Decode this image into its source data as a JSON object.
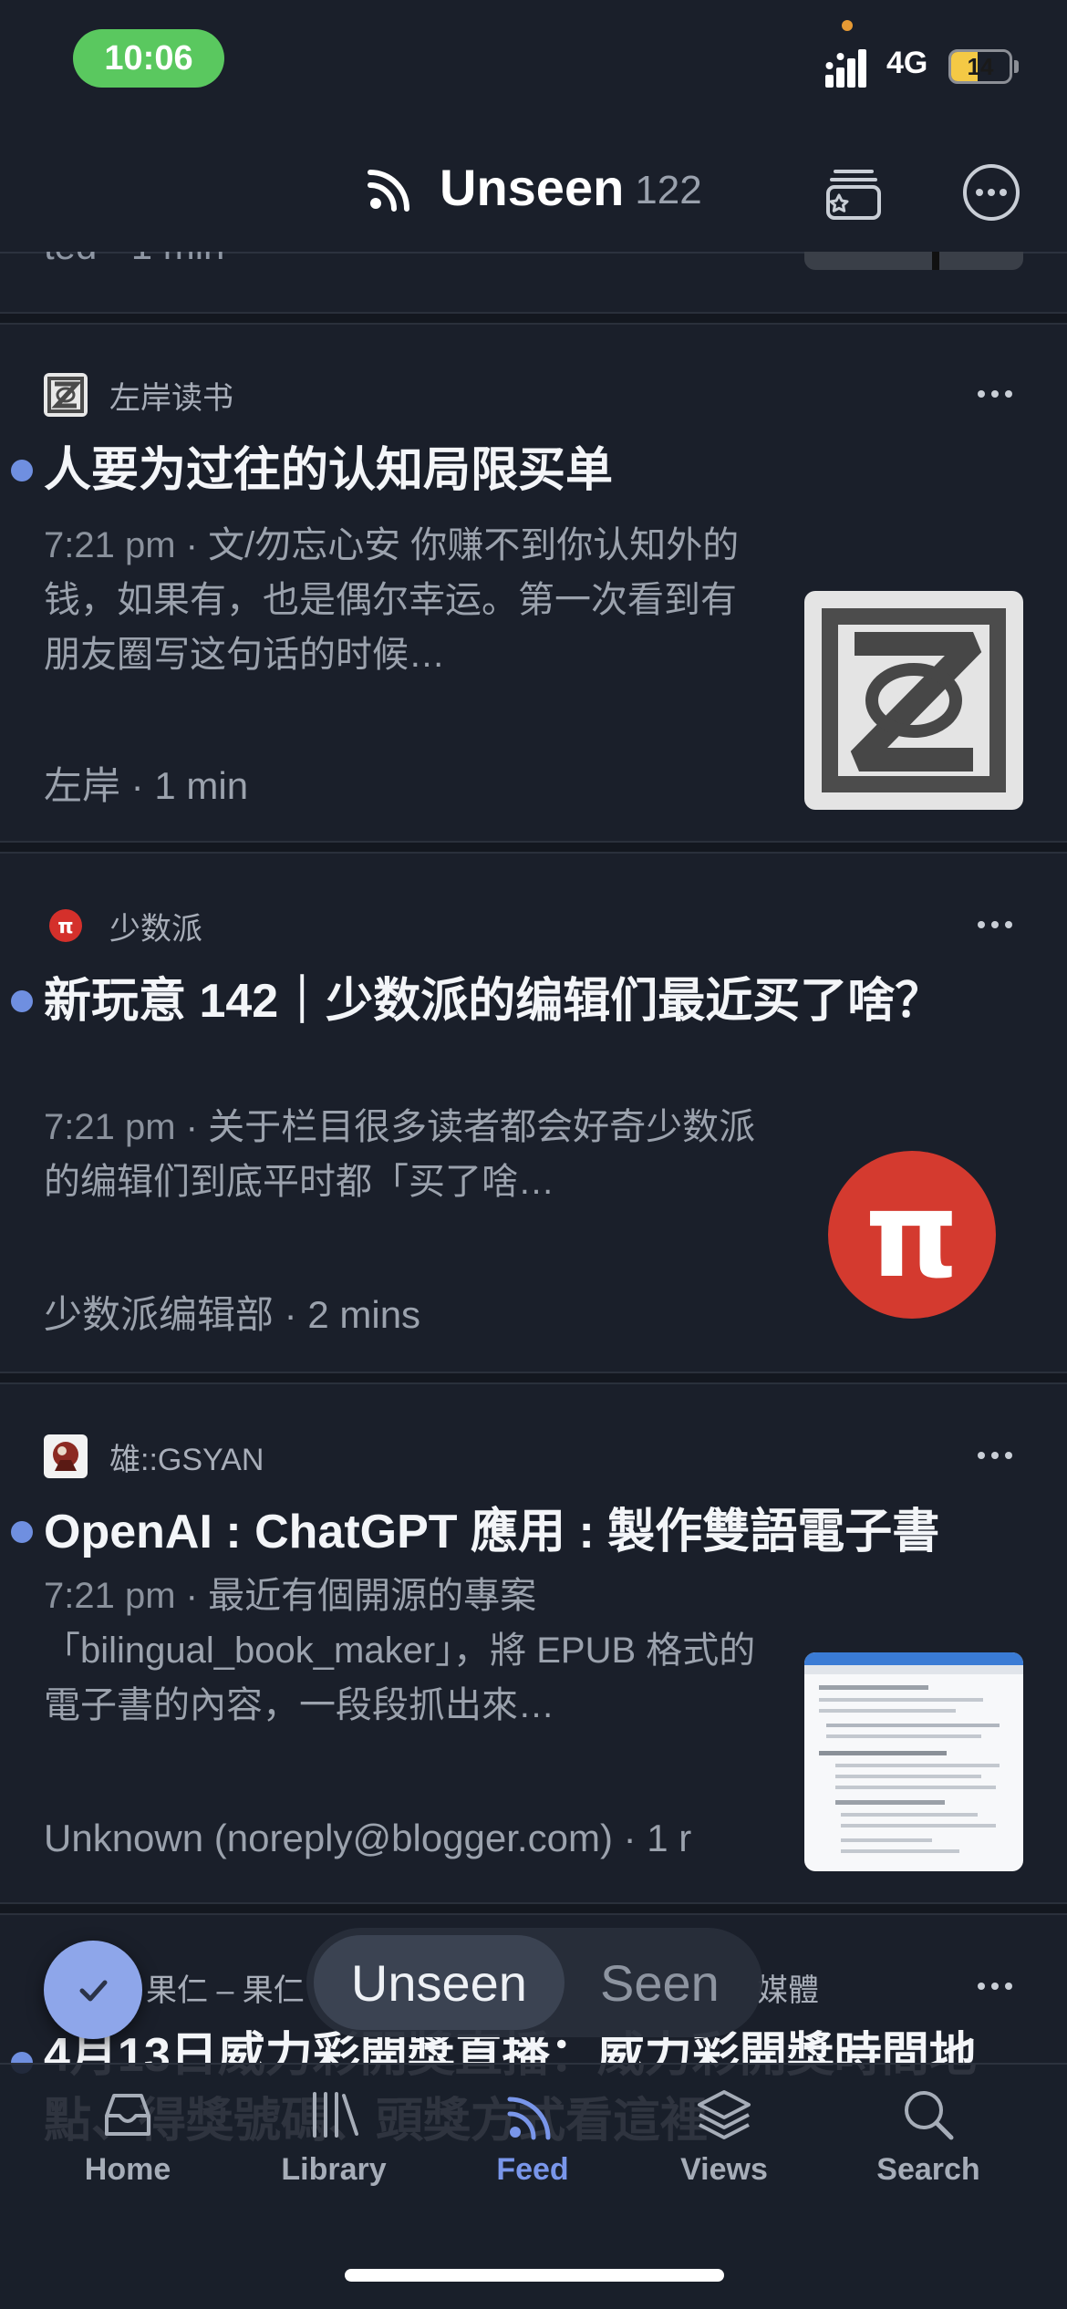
{
  "status_bar": {
    "time": "10:06",
    "network": "4G",
    "battery_level": "14"
  },
  "header": {
    "title": "Unseen",
    "count": "122",
    "stack_icon": "rack-star-icon",
    "more_icon": "ellipsis-circle-icon"
  },
  "previous_item": {
    "byline_tail": "ted · 1 min"
  },
  "articles": [
    {
      "source": "左岸读书",
      "title": "人要为过往的认知局限买单",
      "time": "7:21 pm",
      "summary": "文/勿忘心安 你赚不到你认知外的钱，如果有，也是偶尔幸运。第一次看到有朋友圈写这句话的时候…",
      "author": "左岸",
      "read_time": "1 min",
      "unread": true
    },
    {
      "source": "少数派",
      "title": "新玩意 142｜少数派的编辑们最近买了啥？",
      "time": "7:21 pm",
      "summary": "关于栏目很多读者都会好奇少数派的编辑们到底平时都「买了啥…",
      "author": "少数派编辑部",
      "read_time": "2 mins",
      "unread": true,
      "thumb_text": "π"
    },
    {
      "source": "雄::GSYAN",
      "title": "OpenAI : ChatGPT 應用 : 製作雙語電子書",
      "time": "7:21 pm",
      "summary": "最近有個開源的專案「bilingual_book_maker」，將 EPUB 格式的電子書的內容，一段段抓出來…",
      "author": "Unknown (noreply@blogger.com)",
      "read_time": "1 r",
      "unread": true
    },
    {
      "source_left": "果仁 – 果仁",
      "source_right": "媒體",
      "title": "4月13日威力彩開獎直播：威力彩開獎時間地點、得獎號碼、頭獎方式看這裡",
      "unread": true
    }
  ],
  "segmented": {
    "unseen": "Unseen",
    "seen": "Seen",
    "selected": "Unseen"
  },
  "tabs": [
    {
      "label": "Home",
      "icon": "inbox-icon"
    },
    {
      "label": "Library",
      "icon": "library-icon"
    },
    {
      "label": "Feed",
      "icon": "rss-icon",
      "active": true
    },
    {
      "label": "Views",
      "icon": "layers-icon"
    },
    {
      "label": "Search",
      "icon": "search-icon"
    }
  ],
  "colors": {
    "background": "#1a1f2a",
    "accent": "#7996ea",
    "unread_dot": "#6f8fe0",
    "time_pill": "#5ac85f"
  }
}
